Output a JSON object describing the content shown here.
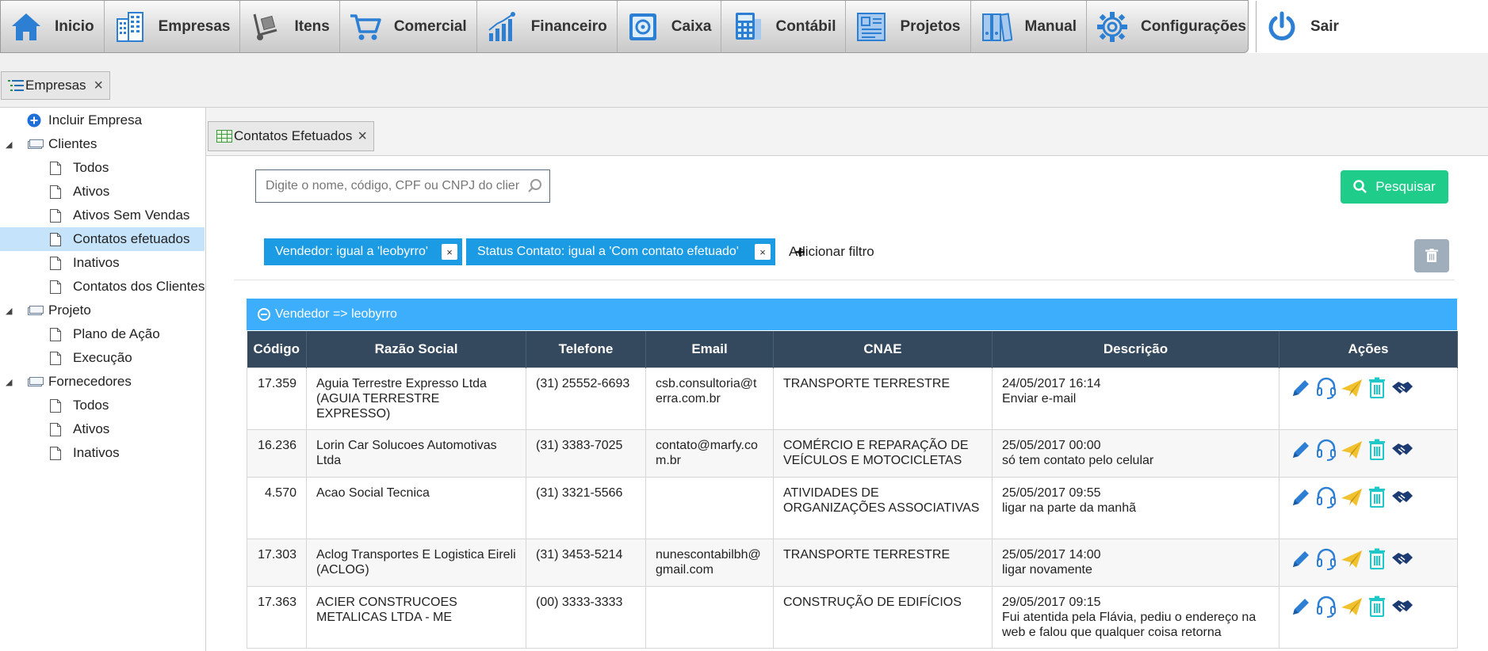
{
  "menu": [
    {
      "id": "inicio",
      "label": "Inicio",
      "icon": "home-icon"
    },
    {
      "id": "empresas",
      "label": "Empresas",
      "icon": "buildings-icon"
    },
    {
      "id": "itens",
      "label": "Itens",
      "icon": "hand-truck-icon"
    },
    {
      "id": "comercial",
      "label": "Comercial",
      "icon": "shopping-cart-icon"
    },
    {
      "id": "financeiro",
      "label": "Financeiro",
      "icon": "bar-chart-icon"
    },
    {
      "id": "caixa",
      "label": "Caixa",
      "icon": "safe-icon"
    },
    {
      "id": "contabil",
      "label": "Contábil",
      "icon": "calculator-icon"
    },
    {
      "id": "projetos",
      "label": "Projetos",
      "icon": "blueprint-icon"
    },
    {
      "id": "manual",
      "label": "Manual",
      "icon": "binders-icon"
    },
    {
      "id": "configuracoes",
      "label": "Configurações",
      "icon": "gear-icon"
    },
    {
      "id": "sair",
      "label": "Sair",
      "icon": "power-icon"
    }
  ],
  "top_tab": {
    "label": "Empresas",
    "close": "×"
  },
  "sidebar": {
    "include_label": "Incluir Empresa",
    "nodes": [
      {
        "label": "Clientes",
        "children": [
          "Todos",
          "Ativos",
          "Ativos Sem Vendas",
          "Contatos efetuados",
          "Inativos",
          "Contatos dos Clientes"
        ]
      },
      {
        "label": "Projeto",
        "children": [
          "Plano de Ação",
          "Execução"
        ]
      },
      {
        "label": "Fornecedores",
        "children": [
          "Todos",
          "Ativos",
          "Inativos"
        ]
      }
    ],
    "selected": "Contatos efetuados"
  },
  "content_tab": {
    "label": "Contatos Efetuados",
    "close": "×"
  },
  "search": {
    "placeholder": "Digite o nome, código, CPF ou CNPJ do cliente",
    "button_label": "Pesquisar"
  },
  "filters": [
    {
      "label": "Vendedor: igual a 'leobyrro'",
      "remove": "×"
    },
    {
      "label": "Status Contato: igual a 'Com contato efetuado'",
      "remove": "×"
    }
  ],
  "add_filter_label": "Adicionar filtro",
  "group_label": "Vendedor => leobyrro",
  "table": {
    "columns": [
      "Código",
      "Razão Social",
      "Telefone",
      "Email",
      "CNAE",
      "Descrição",
      "Ações"
    ],
    "rows": [
      {
        "codigo": "17.359",
        "razao": "Aguia Terrestre Expresso Ltda (AGUIA TERRESTRE EXPRESSO)",
        "telefone": "(31) 25552-6693",
        "email": "csb.consultoria@terra.com.br",
        "cnae": "TRANSPORTE TERRESTRE",
        "data": "24/05/2017 16:14",
        "descricao": "Enviar e-mail"
      },
      {
        "codigo": "16.236",
        "razao": "Lorin Car Solucoes Automotivas Ltda",
        "telefone": "(31) 3383-7025",
        "email": "contato@marfy.com.br",
        "cnae": "COMÉRCIO E REPARAÇÃO DE VEÍCULOS E MOTOCICLETAS",
        "data": "25/05/2017 00:00",
        "descricao": "só tem contato pelo celular"
      },
      {
        "codigo": "4.570",
        "razao": "Acao Social Tecnica",
        "telefone": "(31) 3321-5566",
        "email": "",
        "cnae": "ATIVIDADES DE ORGANIZAÇÕES ASSOCIATIVAS",
        "data": "25/05/2017 09:55",
        "descricao": "ligar na parte da manhã"
      },
      {
        "codigo": "17.303",
        "razao": "Aclog Transportes E Logistica Eireli (ACLOG)",
        "telefone": "(31) 3453-5214",
        "email": "nunescontabilbh@gmail.com",
        "cnae": "TRANSPORTE TERRESTRE",
        "data": "25/05/2017 14:00",
        "descricao": "ligar novamente"
      },
      {
        "codigo": "17.363",
        "razao": "ACIER CONSTRUCOES METALICAS LTDA - ME",
        "telefone": "(00) 3333-3333",
        "email": "",
        "cnae": "CONSTRUÇÃO DE EDIFÍCIOS",
        "data": "29/05/2017 09:15",
        "descricao": "Fui atentida pela Flávia, pediu o endereço na web e falou que qualquer coisa retorna"
      }
    ],
    "actions": [
      "edit-icon",
      "headset-icon",
      "paper-plane-icon",
      "trash-icon",
      "handshake-icon"
    ]
  },
  "colors": {
    "chip": "#1b9be3",
    "group_header": "#3daefc",
    "table_header": "#34495e",
    "search_button": "#1fcc8a",
    "selected_row": "#c5e3fb"
  }
}
